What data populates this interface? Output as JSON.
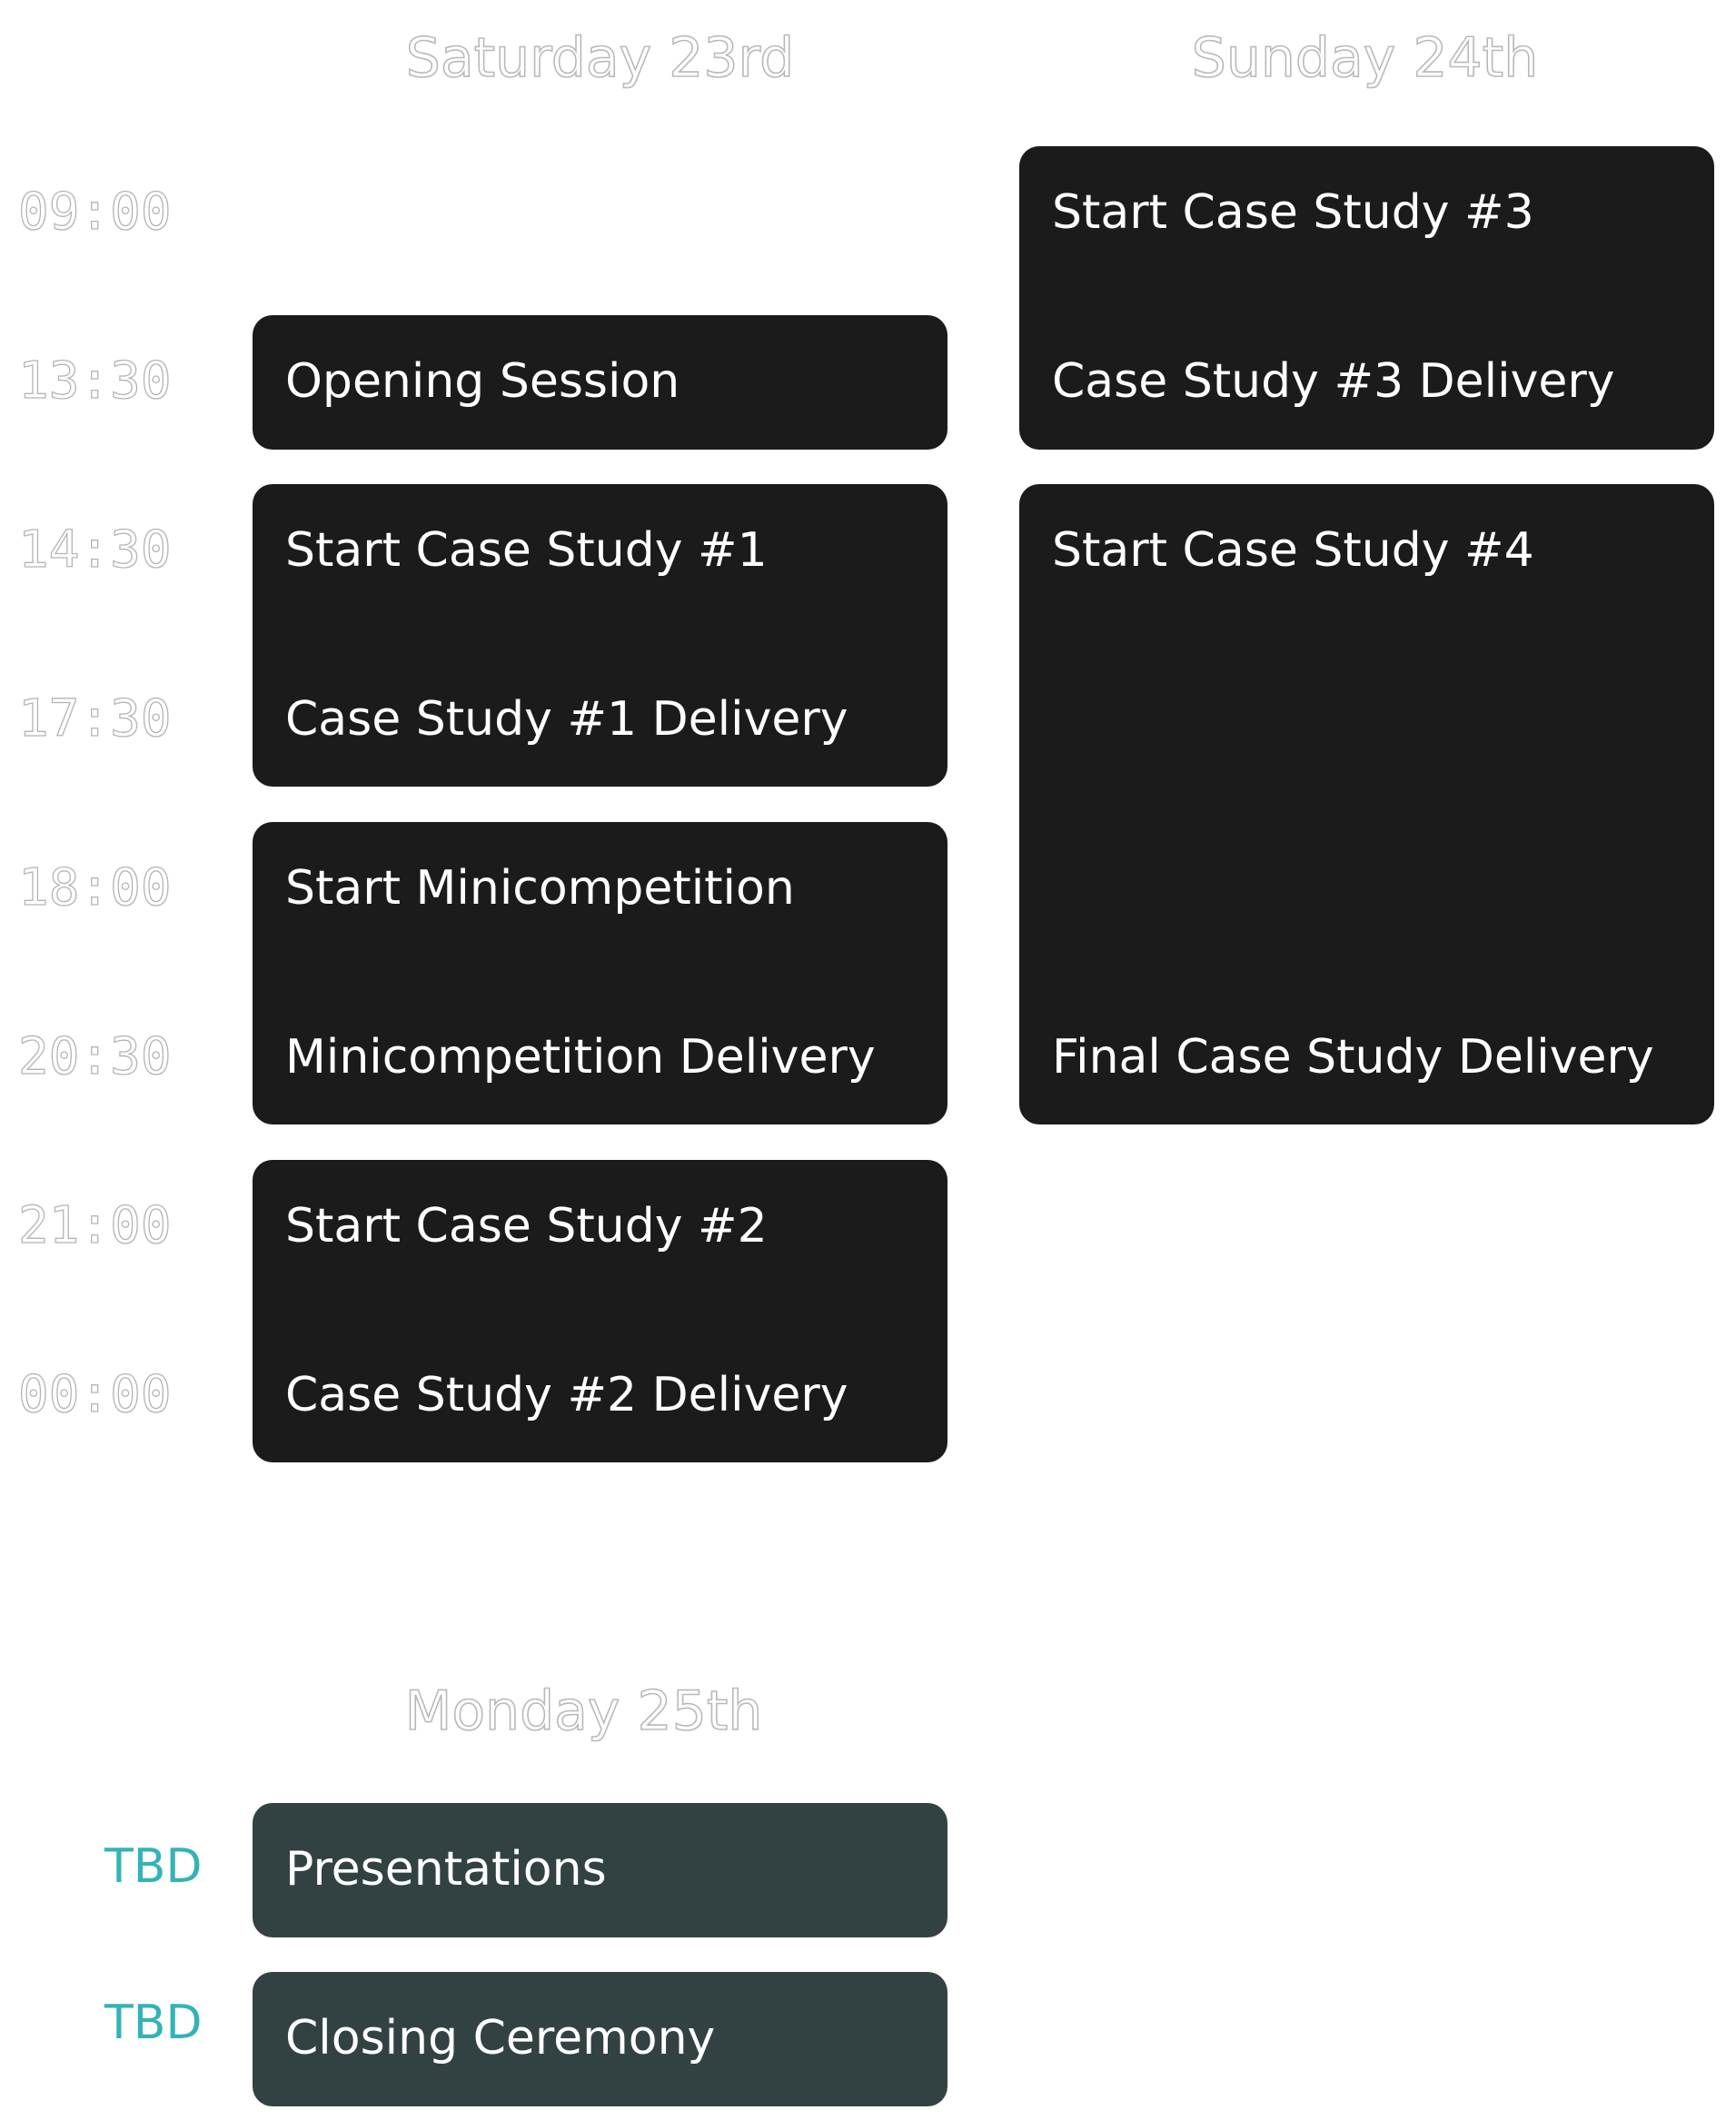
{
  "days": {
    "saturday": {
      "title": "Saturday 23rd"
    },
    "sunday": {
      "title": "Sunday 24th"
    },
    "monday": {
      "title": "Monday 25th"
    }
  },
  "times": [
    "09:00",
    "13:30",
    "14:30",
    "17:30",
    "18:00",
    "20:30",
    "21:00",
    "00:00"
  ],
  "tbd_times": [
    "TBD",
    "TBD"
  ],
  "saturday_events": [
    {
      "start": "Opening Session"
    },
    {
      "start": "Start Case Study #1",
      "end": "Case Study #1 Delivery"
    },
    {
      "start": "Start Minicompetition",
      "end": "Minicompetition Delivery"
    },
    {
      "start": "Start Case Study #2",
      "end": "Case Study #2 Delivery"
    }
  ],
  "sunday_events": [
    {
      "start": "Start Case Study #3",
      "end": "Case Study #3 Delivery"
    },
    {
      "start": "Start Case Study #4",
      "end": "Final Case Study Delivery"
    }
  ],
  "monday_events": [
    {
      "start": "Presentations"
    },
    {
      "start": "Closing Ceremony"
    }
  ],
  "colors": {
    "card_background": "#1b1b1b",
    "monday_card_background": "#324242",
    "tbd_text": "#33b3b8",
    "outline_text": "#b9b9b9"
  }
}
